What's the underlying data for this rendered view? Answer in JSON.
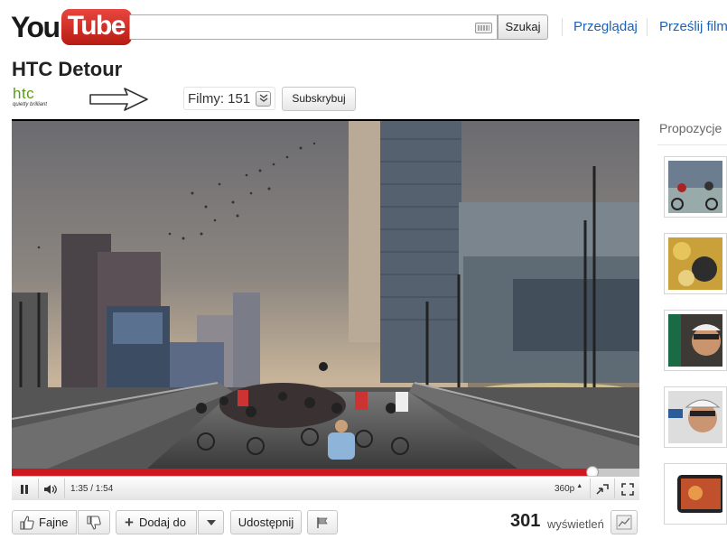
{
  "header": {
    "logo_you": "You",
    "logo_tube": "Tube",
    "search_value": "",
    "search_button": "Szukaj",
    "nav": [
      "Przeglądaj",
      "Prześlij film"
    ]
  },
  "channel": {
    "title": "HTC Detour",
    "logo_text": "htc",
    "logo_tagline": "quietly brilliant",
    "videos_label": "Filmy: 151",
    "subscribe_label": "Subskrybuj"
  },
  "player": {
    "progress": 0.9245,
    "time": "1:35 / 1:54",
    "quality": "360p"
  },
  "actions": {
    "like": "Fajne",
    "add": "Dodaj do",
    "share": "Udostępnij",
    "views_count": "301",
    "views_label": "wyświetleń"
  },
  "sidebar": {
    "title": "Propozycje"
  },
  "colors": {
    "link": "#1c62b9",
    "brand_red": "#cc181e",
    "htc_green": "#5b9a1e"
  },
  "icons": [
    "keyboard-icon",
    "arrow-icon",
    "chevron-down-icon",
    "pause-icon",
    "volume-icon",
    "popout-icon",
    "fullscreen-icon",
    "thumbs-up-icon",
    "thumbs-down-icon",
    "plus-icon",
    "flag-icon",
    "stats-icon"
  ]
}
